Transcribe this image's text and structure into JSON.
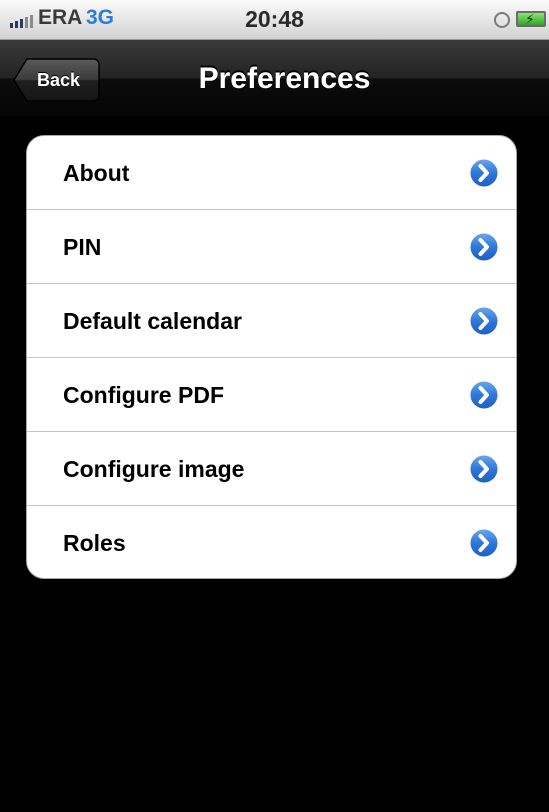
{
  "status_bar": {
    "carrier": "ERA",
    "network": "3G",
    "time": "20:48",
    "icons": [
      "signal-icon",
      "alarm-icon",
      "battery-charging-icon"
    ]
  },
  "nav_bar": {
    "back_label": "Back",
    "title": "Preferences"
  },
  "menu": {
    "items": [
      {
        "label": "About"
      },
      {
        "label": "PIN"
      },
      {
        "label": "Default calendar"
      },
      {
        "label": "Configure PDF"
      },
      {
        "label": "Configure image"
      },
      {
        "label": "Roles"
      }
    ],
    "accessory_icon": "disclosure-chevron-icon"
  },
  "colors": {
    "background": "#000000",
    "accent": "#2b7dd6",
    "disclosure": "#2f77d8"
  }
}
